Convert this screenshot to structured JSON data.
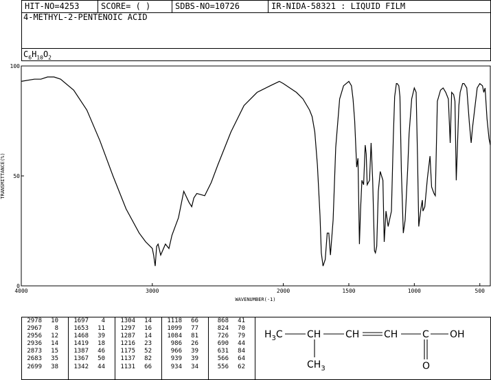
{
  "header": {
    "hit_no": "HIT-NO=4253",
    "score": "SCORE=  (   )",
    "sdbs_no": "SDBS-NO=10726",
    "sample": "IR-NIDA-58321 : LIQUID FILM"
  },
  "compound_name": "4-METHYL-2-PENTENOIC ACID",
  "formula": {
    "c": "C",
    "c_n": "6",
    "h": "H",
    "h_n": "10",
    "o": "O",
    "o_n": "2"
  },
  "chart_data": {
    "type": "line",
    "title": "",
    "xlabel": "WAVENUMBER(-1)",
    "ylabel": "TRANSMITTANCE(%)",
    "xlim": [
      4000,
      420
    ],
    "ylim": [
      0,
      100
    ],
    "x_ticks": [
      4000,
      3000,
      2000,
      1500,
      1000,
      500
    ],
    "x_tick_labels": [
      "4000",
      "3000",
      "2000",
      "1500",
      "1000",
      "500"
    ],
    "y_ticks": [
      0,
      50,
      100
    ],
    "y_tick_labels": [
      "0",
      "50",
      "100"
    ],
    "grid": false,
    "series": [
      {
        "x": [
          4000,
          3900,
          3850,
          3800,
          3750,
          3700,
          3600,
          3500,
          3400,
          3300,
          3200,
          3100,
          3050,
          3000,
          2990,
          2978,
          2967,
          2956,
          2936,
          2900,
          2873,
          2850,
          2800,
          2760,
          2720,
          2699,
          2683,
          2660,
          2600,
          2550,
          2500,
          2400,
          2300,
          2200,
          2100,
          2030,
          2000,
          1950,
          1900,
          1850,
          1800,
          1780,
          1760,
          1740,
          1720,
          1710,
          1697,
          1680,
          1665,
          1653,
          1640,
          1620,
          1600,
          1570,
          1540,
          1500,
          1480,
          1468,
          1455,
          1440,
          1430,
          1419,
          1410,
          1400,
          1387,
          1375,
          1367,
          1360,
          1342,
          1330,
          1318,
          1304,
          1297,
          1287,
          1275,
          1260,
          1240,
          1230,
          1216,
          1200,
          1175,
          1160,
          1150,
          1137,
          1131,
          1118,
          1110,
          1099,
          1084,
          1070,
          1050,
          1040,
          1020,
          1000,
          986,
          975,
          966,
          950,
          939,
          934,
          920,
          900,
          880,
          868,
          850,
          840,
          824,
          800,
          780,
          760,
          740,
          726,
          715,
          700,
          690,
          680,
          660,
          650,
          631,
          620,
          600,
          580,
          566,
          556,
          540,
          520,
          500,
          480,
          470,
          460,
          445,
          430,
          420
        ],
        "y": [
          93,
          94,
          94,
          95,
          95,
          94,
          89,
          80,
          66,
          50,
          35,
          24,
          20,
          17,
          14,
          9,
          18,
          19,
          14,
          19,
          17,
          23,
          31,
          43,
          38,
          36,
          40,
          42,
          41,
          47,
          55,
          70,
          82,
          88,
          91,
          93,
          92,
          90,
          88,
          85,
          80,
          77,
          70,
          55,
          32,
          15,
          9,
          12,
          24,
          24,
          14,
          30,
          63,
          85,
          91,
          93,
          91,
          85,
          75,
          54,
          58,
          19,
          35,
          48,
          46,
          64,
          60,
          46,
          48,
          65,
          48,
          16,
          15,
          18,
          43,
          52,
          48,
          20,
          34,
          27,
          34,
          68,
          86,
          92,
          92,
          91,
          86,
          52,
          24,
          30,
          54,
          69,
          85,
          90,
          88,
          57,
          27,
          35,
          39,
          34,
          36,
          49,
          59,
          45,
          42,
          41,
          84,
          89,
          90,
          88,
          85,
          65,
          88,
          87,
          84,
          48,
          82,
          88,
          92,
          92,
          90,
          74,
          65,
          72,
          80,
          90,
          92,
          91,
          88,
          90,
          76,
          67,
          64
        ]
      }
    ],
    "peaks": [
      [
        [
          2978,
          10
        ],
        [
          2967,
          8
        ],
        [
          2956,
          12
        ],
        [
          2936,
          14
        ],
        [
          2873,
          15
        ],
        [
          2683,
          35
        ],
        [
          2699,
          38
        ]
      ],
      [
        [
          1697,
          4
        ],
        [
          1653,
          11
        ],
        [
          1468,
          39
        ],
        [
          1419,
          18
        ],
        [
          1387,
          46
        ],
        [
          1367,
          50
        ],
        [
          1342,
          44
        ]
      ],
      [
        [
          1304,
          14
        ],
        [
          1297,
          16
        ],
        [
          1287,
          14
        ],
        [
          1216,
          23
        ],
        [
          1175,
          52
        ],
        [
          1137,
          82
        ],
        [
          1131,
          66
        ]
      ],
      [
        [
          1118,
          66
        ],
        [
          1099,
          77
        ],
        [
          1084,
          81
        ],
        [
          986,
          26
        ],
        [
          966,
          39
        ],
        [
          939,
          39
        ],
        [
          934,
          34
        ]
      ],
      [
        [
          868,
          41
        ],
        [
          824,
          70
        ],
        [
          726,
          79
        ],
        [
          690,
          44
        ],
        [
          631,
          84
        ],
        [
          566,
          64
        ],
        [
          556,
          62
        ]
      ]
    ]
  },
  "structure": {
    "h3c": "H3C",
    "ch1": "CH",
    "ch2": "CH",
    "ch3": "CH",
    "c": "C",
    "oh": "OH",
    "o": "O",
    "ch3_sub": "CH3"
  }
}
